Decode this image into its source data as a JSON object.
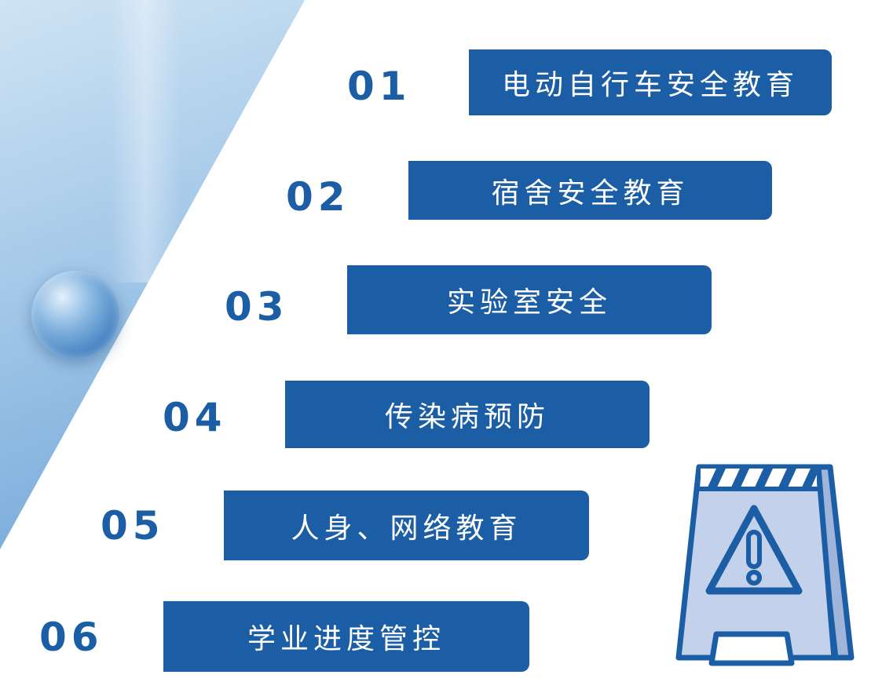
{
  "items": [
    {
      "number": "01",
      "label": "电动自行车安全教育"
    },
    {
      "number": "02",
      "label": "宿舍安全教育"
    },
    {
      "number": "03",
      "label": "实验室安全"
    },
    {
      "number": "04",
      "label": "传染病预防"
    },
    {
      "number": "05",
      "label": "人身、网络教育"
    },
    {
      "number": "06",
      "label": "学业进度管控"
    }
  ],
  "colors": {
    "accent": "#1c5ea6",
    "label_text": "#ffffff",
    "sign_fill": "#b9c9e3",
    "sign_stroke": "#1c5ea6"
  },
  "icons": {
    "background_bubble": "water-bubble",
    "warning": "caution-sign-icon"
  }
}
